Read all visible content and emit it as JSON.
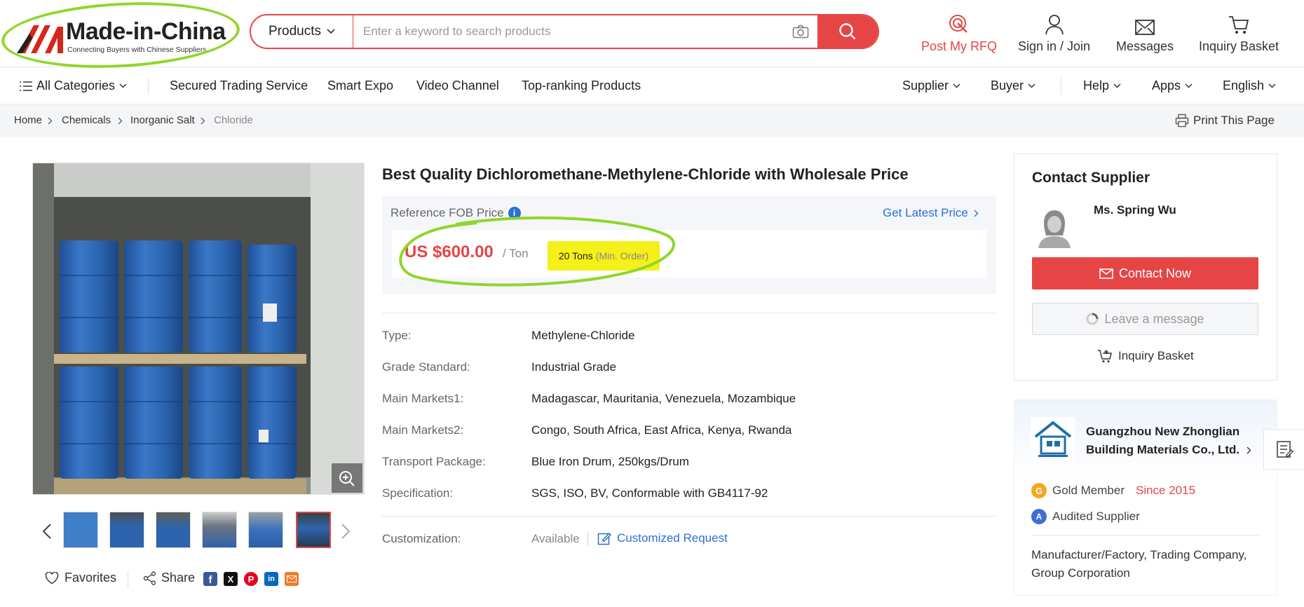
{
  "header": {
    "logo_title": "Made-in-China",
    "logo_sub": "Connecting Buyers with Chinese Suppliers",
    "search_category": "Products",
    "search_placeholder": "Enter a keyword to search products",
    "nav": {
      "post_rfq": "Post My RFQ",
      "sign_in": "Sign in / Join",
      "messages": "Messages",
      "inquiry_basket": "Inquiry Basket"
    }
  },
  "subnav": {
    "all_categories": "All Categories",
    "links": [
      "Secured Trading Service",
      "Smart Expo",
      "Video Channel",
      "Top-ranking Products"
    ],
    "right": [
      "Supplier",
      "Buyer",
      "Help",
      "Apps",
      "English"
    ]
  },
  "breadcrumb": {
    "items": [
      "Home",
      "Chemicals",
      "Inorganic Salt",
      "Chloride"
    ],
    "print": "Print This Page"
  },
  "product": {
    "title": "Best Quality Dichloromethane-Methylene-Chloride with Wholesale Price",
    "price_label": "Reference FOB Price",
    "latest_price": "Get Latest Price",
    "price": "US $600.00",
    "unit": "/ Ton",
    "min_qty": "20 Tons",
    "min_label": "(Min. Order)",
    "specs": [
      {
        "label": "Type:",
        "value": "Methylene-Chloride"
      },
      {
        "label": "Grade Standard:",
        "value": "Industrial Grade"
      },
      {
        "label": "Main Markets1:",
        "value": "Madagascar, Mauritania, Venezuela, Mozambique"
      },
      {
        "label": "Main Markets2:",
        "value": "Congo, South Africa, East Africa, Kenya, Rwanda"
      },
      {
        "label": "Transport Package:",
        "value": "Blue Iron Drum, 250kgs/Drum"
      },
      {
        "label": "Specification:",
        "value": "SGS, ISO, BV, Conformable with GB4117-92"
      }
    ],
    "customization_label": "Customization:",
    "customization_value": "Available",
    "customized_request": "Customized Request",
    "favorites": "Favorites",
    "share": "Share",
    "thumb_count": 6,
    "selected_thumb": 6
  },
  "contact": {
    "heading": "Contact Supplier",
    "name": "Ms. Spring Wu",
    "contact_now": "Contact Now",
    "leave_message": "Leave a message",
    "inquiry_basket": "Inquiry Basket"
  },
  "company": {
    "name_line1": "Guangzhou New Zhonglian",
    "name_line2": "Building Materials Co., Ltd.",
    "gold_member": "Gold Member",
    "since": "Since 2015",
    "audited": "Audited Supplier",
    "business_type": "Manufacturer/Factory, Trading Company, Group Corporation"
  },
  "colors": {
    "brand_red": "#e64545",
    "link_blue": "#2b6fd6",
    "highlight_yellow": "#f5ef1a",
    "annotation_green": "#8fd62a"
  }
}
